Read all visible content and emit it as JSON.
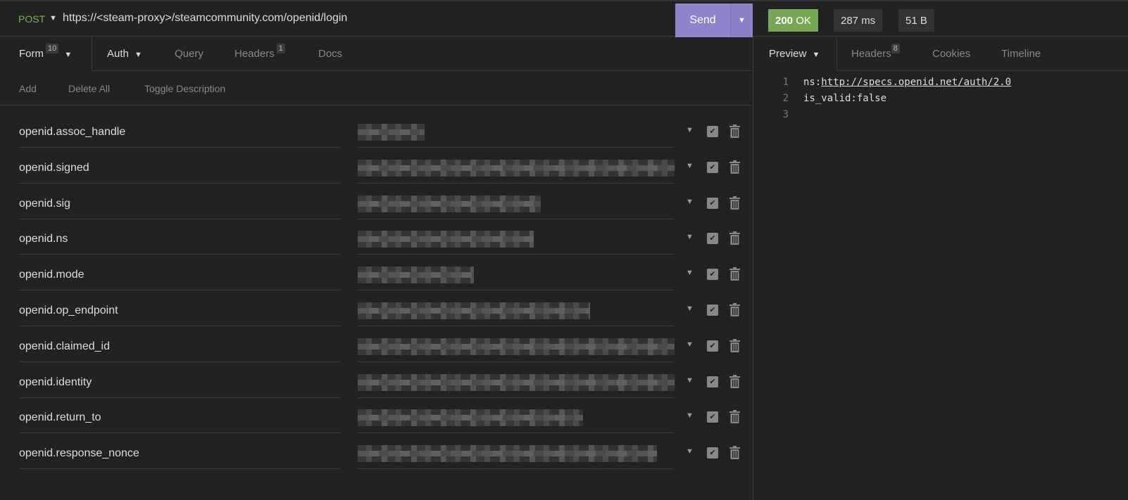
{
  "request": {
    "method": "POST",
    "url": "https://<steam-proxy>/steamcommunity.com/openid/login",
    "send_label": "Send"
  },
  "response": {
    "status": "200 OK",
    "status_code": "200",
    "status_text": "OK",
    "time": "287 ms",
    "size": "51 B",
    "status_color": "#75a755"
  },
  "request_tabs": [
    {
      "label": "Form",
      "badge": "10"
    },
    {
      "label": "Auth"
    },
    {
      "label": "Query"
    },
    {
      "label": "Headers",
      "badge": "1"
    },
    {
      "label": "Docs"
    }
  ],
  "form_toolbar": {
    "add": "Add",
    "delete_all": "Delete All",
    "toggle_description": "Toggle Description"
  },
  "form_rows": [
    {
      "name": "openid.assoc_handle"
    },
    {
      "name": "openid.signed"
    },
    {
      "name": "openid.sig"
    },
    {
      "name": "openid.ns"
    },
    {
      "name": "openid.mode"
    },
    {
      "name": "openid.op_endpoint"
    },
    {
      "name": "openid.claimed_id"
    },
    {
      "name": "openid.identity"
    },
    {
      "name": "openid.return_to"
    },
    {
      "name": "openid.response_nonce"
    }
  ],
  "response_tabs": [
    {
      "label": "Preview"
    },
    {
      "label": "Headers",
      "badge": "8"
    },
    {
      "label": "Cookies"
    },
    {
      "label": "Timeline"
    }
  ],
  "preview": {
    "lines": [
      {
        "n": "1",
        "prefix": "ns:",
        "link": "http://specs.openid.net/auth/2.0"
      },
      {
        "n": "2",
        "text": "is_valid:false"
      },
      {
        "n": "3",
        "text": ""
      }
    ]
  }
}
